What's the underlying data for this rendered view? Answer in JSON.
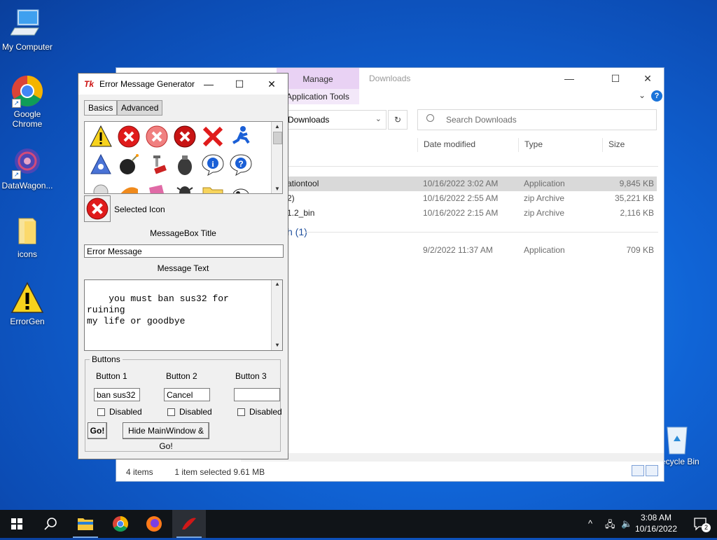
{
  "desktop": {
    "icons": [
      {
        "label": "My Computer"
      },
      {
        "label": "Google Chrome"
      },
      {
        "label": "DataWagon..."
      },
      {
        "label": "icons"
      },
      {
        "label": "ErrorGen"
      },
      {
        "label": "Recycle Bin"
      }
    ]
  },
  "explorer": {
    "ribbon_tab": "Manage",
    "ribbon_subtab": "Application Tools",
    "title": "Downloads",
    "address": "Downloads",
    "search_placeholder": "Search Downloads",
    "columns": [
      "Date modified",
      "Type",
      "Size"
    ],
    "rows": [
      {
        "name": "ationtool",
        "date": "10/16/2022 3:02 AM",
        "type": "Application",
        "size": "9,845 KB",
        "selected": true
      },
      {
        "name": "2)",
        "date": "10/16/2022 2:55 AM",
        "type": "zip Archive",
        "size": "35,221 KB",
        "selected": false
      },
      {
        "name": "1.2_bin",
        "date": "10/16/2022 2:15 AM",
        "type": "zip Archive",
        "size": "2,116 KB",
        "selected": false
      }
    ],
    "group_label": "h (1)",
    "group_rows": [
      {
        "name": "",
        "date": "9/2/2022 11:37 AM",
        "type": "Application",
        "size": "709 KB"
      }
    ],
    "status_items": "4 items",
    "status_selected": "1 item selected  9.61 MB"
  },
  "errorgen": {
    "logo": "Tk",
    "title": "Error Message Generator",
    "tabs": [
      "Basics",
      "Advanced"
    ],
    "selected_icon_label": "Selected Icon",
    "title_label": "MessageBox Title",
    "title_value": "Error Message",
    "text_label": "Message Text",
    "text_value": "you must ban sus32 for ruining\nmy life or goodbye",
    "buttons_group": "Buttons",
    "button1_label": "Button 1",
    "button2_label": "Button 2",
    "button3_label": "Button 3",
    "button1_value": "ban sus32",
    "button2_value": "Cancel",
    "button3_value": "",
    "disabled_label": "Disabled",
    "go_label": "Go!",
    "hide_go_label": "Hide MainWindow & Go!"
  },
  "taskbar": {
    "time": "3:08 AM",
    "date": "10/16/2022",
    "notification_count": "2"
  },
  "colors": {
    "error_red": "#e01b1b",
    "warning_yellow": "#f7d21c",
    "manage_tab": "#e9d2f4",
    "selection": "#d9d9d9"
  }
}
